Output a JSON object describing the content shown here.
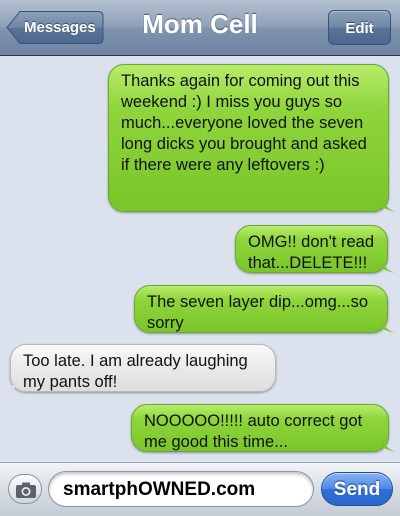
{
  "navbar": {
    "title": "Mom Cell",
    "back_label": "Messages",
    "edit_label": "Edit"
  },
  "messages": [
    {
      "side": "sent",
      "text": "Thanks again for coming out this weekend :) I miss you guys so much...everyone loved the seven long dicks you brought and asked if there were any leftovers :)"
    },
    {
      "side": "sent",
      "text": "OMG!! don't read that...DELETE!!!"
    },
    {
      "side": "sent",
      "text": "The seven layer dip...omg...so sorry"
    },
    {
      "side": "received",
      "text": "Too late. I am already laughing my pants off!"
    },
    {
      "side": "sent",
      "text": "NOOOOO!!!!! auto correct got me good this time..."
    }
  ],
  "composer": {
    "field_text": "smartphOWNED.com",
    "send_label": "Send",
    "camera_icon": "camera-icon"
  },
  "colors": {
    "sent_bubble": "#8fd53c",
    "received_bubble": "#ececec",
    "background": "#dbe2ed",
    "send_button": "#3a78dd"
  }
}
